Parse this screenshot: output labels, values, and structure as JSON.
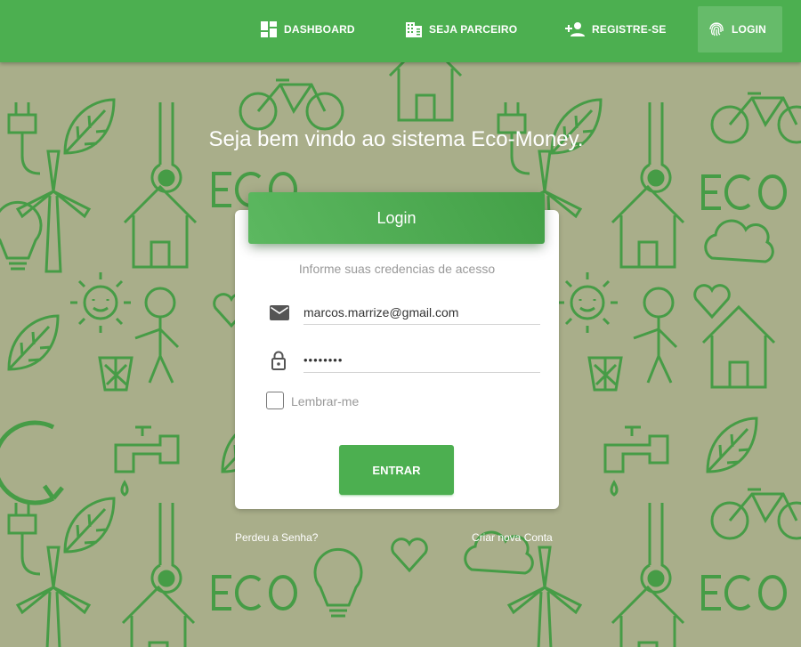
{
  "nav": {
    "items": [
      {
        "label": "DASHBOARD",
        "icon": "dashboard-icon"
      },
      {
        "label": "SEJA PARCEIRO",
        "icon": "building-icon"
      },
      {
        "label": "REGISTRE-SE",
        "icon": "person-add-icon"
      },
      {
        "label": "LOGIN",
        "icon": "fingerprint-icon",
        "active": true
      }
    ]
  },
  "welcome_text": "Seja bem vindo ao sistema Eco-Money.",
  "login_card": {
    "title": "Login",
    "subtitle": "Informe suas credencias de acesso",
    "email_value": "marcos.marrize@gmail.com",
    "password_value": "••••••••",
    "remember_label": "Lembrar-me",
    "remember_checked": false,
    "submit_label": "ENTRAR"
  },
  "links": {
    "forgot_password": "Perdeu a Senha?",
    "create_account": "Criar nova Conta"
  },
  "colors": {
    "primary": "#4caf50",
    "background": "#a9ae8a",
    "doodle": "#3c9a3f"
  }
}
